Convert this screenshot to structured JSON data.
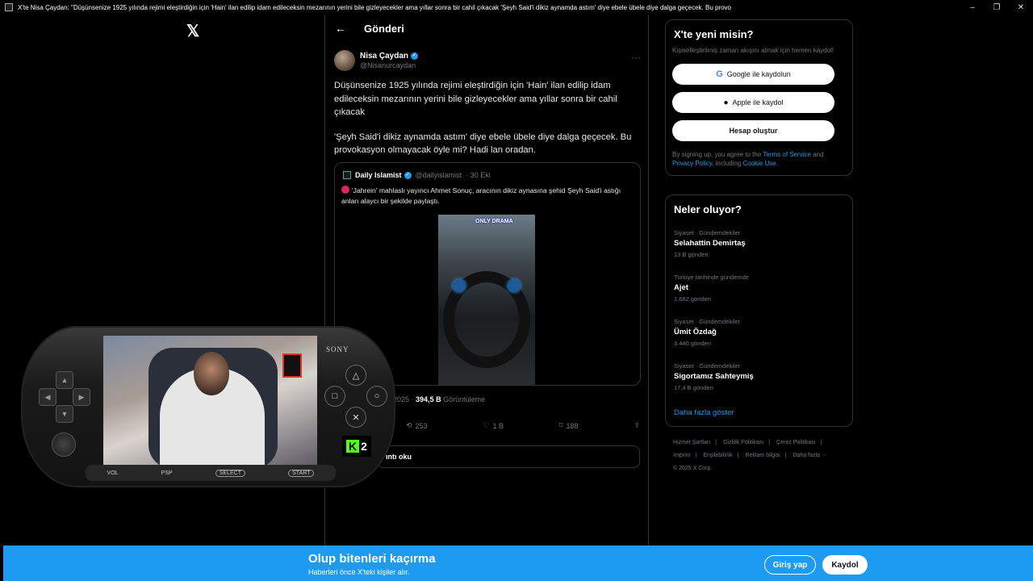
{
  "window": {
    "title": "X'te Nisa Çaydan: \"Düşünsenize 1925 yılında rejimi eleştirdiğin için 'Hain' ilan edilip idam edileceksin mezarının yerini bile gizleyecekler ama yıllar sonra bir cahil çıkacak 'Şeyh Said'i dikiz aynamda astım' diye ebele übele diye dalga geçecek. Bu provo",
    "minimize": "–",
    "maximize": "❐",
    "close": "✕"
  },
  "nav": {
    "logo": "𝕏"
  },
  "post_header": {
    "back": "←",
    "title": "Gönderi"
  },
  "author": {
    "name": "Nisa Çaydan",
    "handle": "@Nisanurcaydan",
    "more": "···"
  },
  "tweet": {
    "para1": "Düşünsenize 1925 yılında rejimi eleştirdiğin için 'Hain' ilan edilip idam edileceksin mezarının yerini bile gizleyecekler ama  yıllar sonra bir cahil çıkacak",
    "para2": "'Şeyh Said'i dikiz aynamda astım' diye ebele übele diye dalga geçecek. Bu provokasyon olmayacak öyle mi? Hadi lan oradan."
  },
  "quote": {
    "name": "Daily Islamist",
    "handle": "@dailyislamist",
    "date": "· 30 Eki",
    "text": "'Jahrein' mahlaslı yayıncı Ahmet Sonuç, aracının dikiz aynasına şehid Şeyh Said'i astığı anları alaycı bir şekilde paylaştı.",
    "media_logo": "ONLY DRAMA"
  },
  "stats": {
    "date_fragment": "2025 ·",
    "views_value": "394,5 B",
    "views_label": "Görüntüleme"
  },
  "actions": {
    "retweets": "253",
    "likes": "1 B",
    "bookmarks": "188"
  },
  "read_replies": "ıntı oku",
  "signup": {
    "title": "X'te yeni misin?",
    "subtitle": "Kişiselleştirilmiş zaman akışını almak için hemen kaydol!",
    "google": "Google ile kaydolun",
    "apple": "Apple ile kaydol",
    "create": "Hesap oluştur",
    "terms_pre": "By signing up, you agree to the",
    "terms_link": "Terms of Service",
    "terms_and": "and",
    "privacy_link": "Privacy Policy",
    "including": ", including",
    "cookie_link": "Cookie Use."
  },
  "trends": {
    "title": "Neler oluyor?",
    "items": [
      {
        "context": "Siyaset · Gündemdekiler",
        "name": "Selahattin Demirtaş",
        "posts": "13 B gönderi"
      },
      {
        "context": "Türkiye tarihinde gündemde",
        "name": "Ajet",
        "posts": "1.682 gönderi"
      },
      {
        "context": "Siyaset · Gündemdekiler",
        "name": "Ümit Özdağ",
        "posts": "3.440 gönderi"
      },
      {
        "context": "Siyaset · Gündemdekiler",
        "name": "Sigortamız Sahteymiş",
        "posts": "17,4 B gönderi"
      }
    ],
    "show_more": "Daha fazla göster"
  },
  "footer": {
    "links": [
      "Hizmet Şartları",
      "|",
      "Gizlilik Politikası",
      "|",
      "Çerez Politikası",
      "|",
      "Imprint",
      "|",
      "Erişilebilirlik",
      "|",
      "Reklam bilgisi",
      "|",
      "Daha fazla ···"
    ],
    "copyright": "© 2025 X Corp."
  },
  "banner": {
    "title": "Olup bitenleri kaçırma",
    "subtitle": "Haberleri önce X'teki kişiler alır.",
    "login": "Giriş yap",
    "register": "Kaydol"
  },
  "overlay": {
    "brand": "SONY",
    "triangle": "△",
    "square": "□",
    "circle": "○",
    "cross": "✕",
    "vol": "VOL",
    "psp": "PSP",
    "select": "SELECT",
    "start": "START",
    "kick_letter": "K",
    "kick_num": "2"
  }
}
